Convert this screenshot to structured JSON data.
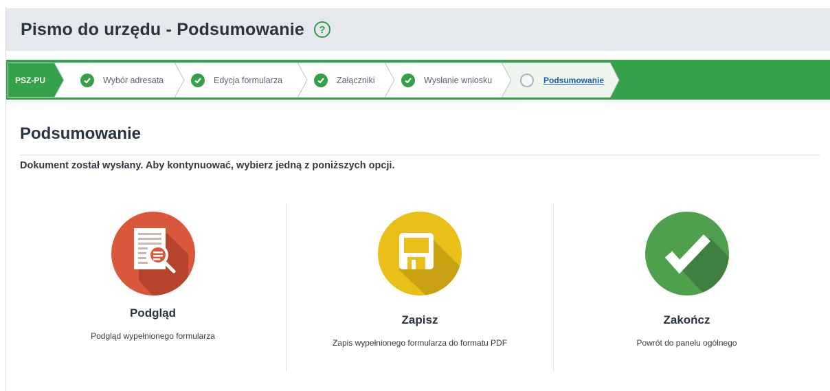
{
  "header": {
    "title": "Pismo do urzędu - Podsumowanie",
    "help_icon": "?"
  },
  "stepper": {
    "code": "PSZ-PU",
    "steps": [
      {
        "label": "Wybór adresata",
        "status": "done"
      },
      {
        "label": "Edycja formularza",
        "status": "done"
      },
      {
        "label": "Załączniki",
        "status": "done"
      },
      {
        "label": "Wysłanie wniosku",
        "status": "done"
      },
      {
        "label": "Podsumowanie",
        "status": "active"
      }
    ]
  },
  "main": {
    "section_title": "Podsumowanie",
    "instruction": "Dokument został wysłany. Aby kontynuować, wybierz jedną z poniższych opcji.",
    "options": [
      {
        "title": "Podgląd",
        "description": "Podgląd wypełnionego formularza",
        "icon": "document-magnifier-icon",
        "color": "#d9573b"
      },
      {
        "title": "Zapisz",
        "description": "Zapis wypełnionego formularza do formatu PDF",
        "icon": "floppy-disk-icon",
        "color": "#e9bf18"
      },
      {
        "title": "Zakończ",
        "description": "Powrót do panelu ogólnego",
        "icon": "checkmark-icon",
        "color": "#4fa04c"
      }
    ]
  },
  "colors": {
    "accent_green": "#35a14b",
    "header_bg": "#e5e8ed",
    "active_step_bg": "#eef5ef",
    "link_blue": "#1d5ea8"
  }
}
